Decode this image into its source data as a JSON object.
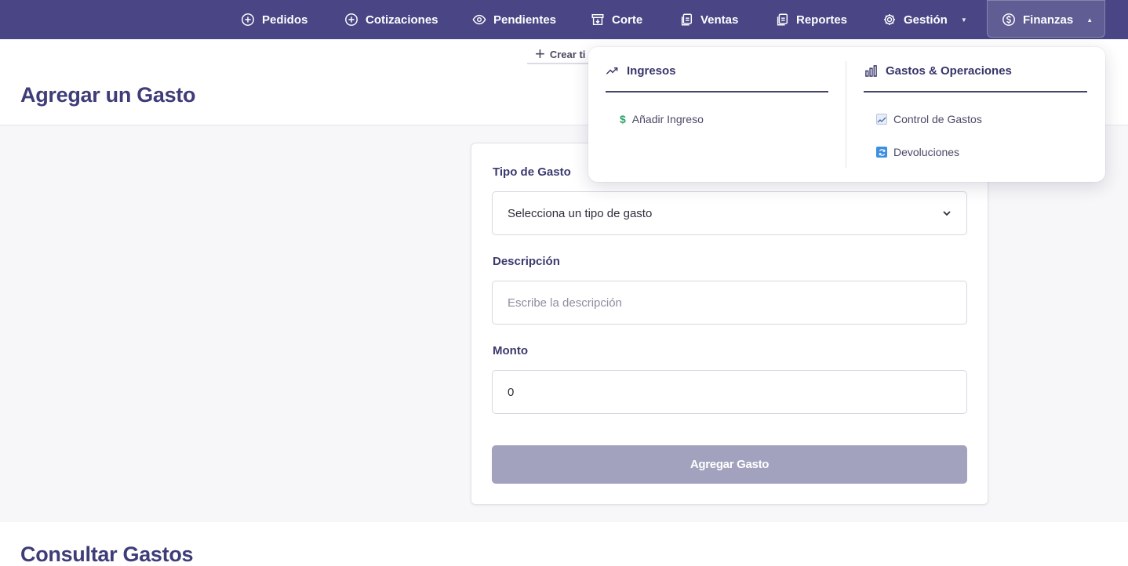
{
  "nav": {
    "items": [
      {
        "label": "Pedidos",
        "icon": "plus-circle-icon"
      },
      {
        "label": "Cotizaciones",
        "icon": "plus-circle-icon"
      },
      {
        "label": "Pendientes",
        "icon": "eye-icon"
      },
      {
        "label": "Corte",
        "icon": "archive-icon"
      },
      {
        "label": "Ventas",
        "icon": "copy-icon"
      },
      {
        "label": "Reportes",
        "icon": "copy-icon"
      },
      {
        "label": "Gestión",
        "icon": "gear-icon"
      },
      {
        "label": "Finanzas",
        "icon": "dollar-circle-icon"
      }
    ]
  },
  "header": {
    "create_link": "Crear ti",
    "page_title": "Agregar un Gasto"
  },
  "form": {
    "tipo_label": "Tipo de Gasto",
    "tipo_value": "Selecciona un tipo de gasto",
    "descripcion_label": "Descripción",
    "descripcion_placeholder": "Escribe la descripción",
    "monto_label": "Monto",
    "monto_value": "0",
    "submit_label": "Agregar Gasto"
  },
  "section": {
    "consultar_title": "Consultar Gastos"
  },
  "dropdown": {
    "col1": {
      "title": "Ingresos",
      "items": [
        {
          "label": "Añadir Ingreso",
          "icon": "dollar-icon"
        }
      ]
    },
    "col2": {
      "title": "Gastos & Operaciones",
      "items": [
        {
          "label": "Control de Gastos",
          "icon": "chart-up-icon"
        },
        {
          "label": "Devoluciones",
          "icon": "refresh-icon"
        }
      ]
    }
  },
  "colors": {
    "nav_bg": "#4a4686",
    "title": "#3f3d78",
    "button_disabled": "#a2a2bf",
    "accent_green": "#2fa36b"
  }
}
